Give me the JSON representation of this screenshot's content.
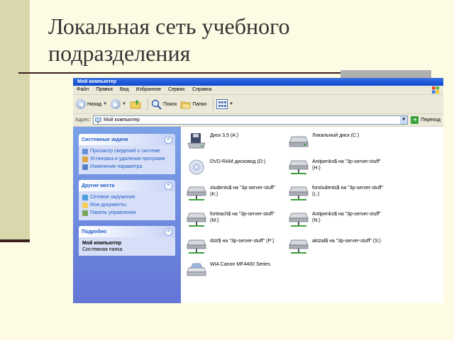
{
  "slide": {
    "title_line1": "Локальная сеть учебного",
    "title_line2": "подразделения"
  },
  "window": {
    "title": "Мой компьютер",
    "menu": [
      "Файл",
      "Правка",
      "Вид",
      "Избранное",
      "Сервис",
      "Справка"
    ],
    "toolbar": {
      "back_label": "Назад",
      "search_label": "Поиск",
      "folders_label": "Папки"
    },
    "address": {
      "label": "Адрес:",
      "value": "Мой компьютер",
      "go_label": "Переход"
    },
    "taskpane": {
      "system_tasks": {
        "title": "Системные задачи",
        "items": [
          "Просмотр сведений о системе",
          "Установка и удаление программ",
          "Изменение параметра"
        ]
      },
      "other_places": {
        "title": "Другие места",
        "items": [
          "Сетевое окружение",
          "Мои документы",
          "Панель управления"
        ]
      },
      "details": {
        "title": "Подробно",
        "name": "Мой компьютер",
        "type": "Системная папка"
      }
    },
    "files": [
      {
        "line1": "Диск 3,5 (A:)",
        "line2": "",
        "icon": "floppy-icon"
      },
      {
        "line1": "Локальный диск (C:)",
        "line2": "",
        "icon": "local-drive-icon"
      },
      {
        "line1": "DVD-RAM дисковод (D:)",
        "line2": "",
        "icon": "dvd-icon"
      },
      {
        "line1": "Antipenko$ на \"3p-server-stuff\"",
        "line2": "(H:)",
        "icon": "network-drive-icon"
      },
      {
        "line1": "students$ на \"3p-server-stuff\"",
        "line2": "(K:)",
        "icon": "network-drive-icon"
      },
      {
        "line1": "forstudents$ на \"3p-server-stuff\"",
        "line2": "(L:)",
        "icon": "network-drive-icon"
      },
      {
        "line1": "forteach$ на \"3p-server-stuff\"",
        "line2": "(M:)",
        "icon": "network-drive-icon"
      },
      {
        "line1": "Antipenko$ на \"3p-server-stuff\"",
        "line2": "(N:)",
        "icon": "network-drive-icon"
      },
      {
        "line1": "dstr$ на \"3p-server-stuff\" (P:)",
        "line2": "",
        "icon": "network-drive-icon"
      },
      {
        "line1": "aktzal$ на \"3p-server-stuff\" (S:)",
        "line2": "",
        "icon": "network-drive-icon"
      },
      {
        "line1": "WIA Canon MF4400 Series",
        "line2": "",
        "icon": "scanner-icon"
      }
    ]
  }
}
